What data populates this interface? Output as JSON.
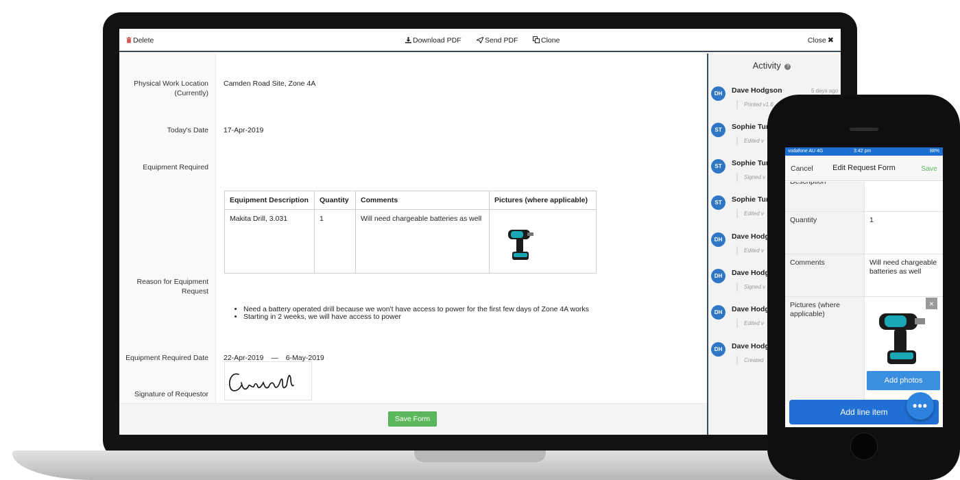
{
  "toolbar": {
    "delete": "Delete",
    "download_pdf": "Download PDF",
    "send_pdf": "Send PDF",
    "clone": "Clone",
    "close": "Close"
  },
  "form": {
    "location_label": "Physical Work Location (Currently)",
    "location_value": "Camden Road Site, Zone 4A",
    "date_label": "Today's Date",
    "date_value": "17-Apr-2019",
    "equipment_label": "Equipment Required",
    "equipment_table": {
      "headers": [
        "Equipment Description",
        "Quantity",
        "Comments",
        "Pictures (where applicable)"
      ],
      "rows": [
        {
          "description": "Makita Drill, 3.031",
          "quantity": "1",
          "comments": "Will need chargeable batteries as well"
        }
      ]
    },
    "reason_label": "Reason for Equipment Request",
    "reason_items": [
      "Need a battery operated drill because we won't have access to power for the first few days of Zone 4A works",
      "Starting in 2 weeks, we will have access to power"
    ],
    "required_date_label": "Equipment Required Date",
    "required_date_start": "22-Apr-2019",
    "required_date_sep": "—",
    "required_date_end": "6-May-2019",
    "signature_label": "Signature of Requestor",
    "save_button": "Save Form"
  },
  "activity": {
    "title": "Activity",
    "items": [
      {
        "initials": "DH",
        "name": "Dave Hodgson",
        "time": "5 days ago",
        "action": "Printed v1.6"
      },
      {
        "initials": "ST",
        "name": "Sophie Tur",
        "time": "",
        "action": "Edited v"
      },
      {
        "initials": "ST",
        "name": "Sophie Tur",
        "time": "",
        "action": "Signed v"
      },
      {
        "initials": "ST",
        "name": "Sophie Tur",
        "time": "",
        "action": "Edited v"
      },
      {
        "initials": "DH",
        "name": "Dave Hodg",
        "time": "",
        "action": "Edited v"
      },
      {
        "initials": "DH",
        "name": "Dave Hodg",
        "time": "",
        "action": "Signed v"
      },
      {
        "initials": "DH",
        "name": "Dave Hodg",
        "time": "",
        "action": "Edited v"
      },
      {
        "initials": "DH",
        "name": "Dave Hodg",
        "time": "",
        "action": "Created"
      }
    ]
  },
  "phone": {
    "status_left": "vodafone AU  4G",
    "status_time": "3:42 pm",
    "status_battery": "88%",
    "nav_cancel": "Cancel",
    "nav_title": "Edit Request Form",
    "nav_save": "Save",
    "rows": [
      {
        "label": "Description",
        "value": ""
      },
      {
        "label": "Quantity",
        "value": "1"
      },
      {
        "label": "Comments",
        "value": "Will need chargeable batteries as well"
      },
      {
        "label": "Pictures (where applicable)",
        "value": ""
      }
    ],
    "add_photos": "Add photos",
    "add_line_item": "Add line item",
    "fab": "•••"
  },
  "colors": {
    "accent_blue": "#2f76c5",
    "save_green": "#5cb85c",
    "delete_red": "#d9534f"
  },
  "icons": [
    "trash-icon",
    "download-icon",
    "send-icon",
    "clone-icon",
    "close-icon",
    "help-icon",
    "drill-image",
    "signature-image",
    "more-icon"
  ]
}
